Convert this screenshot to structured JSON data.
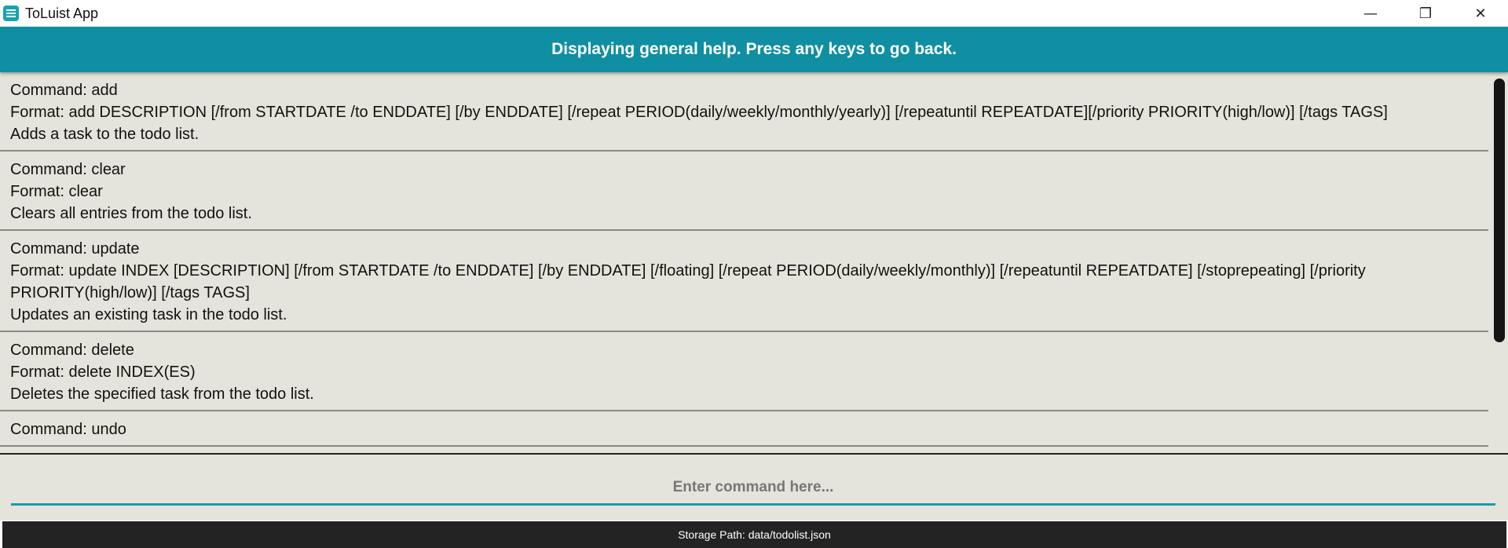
{
  "window": {
    "title": "ToLuist App",
    "icon": "checklist-icon",
    "controls": {
      "minimize": "—",
      "restore": "❐",
      "close": "✕"
    }
  },
  "banner": {
    "text": "Displaying general help. Press any keys to go back.",
    "color": "#0f8fa1"
  },
  "help": {
    "entries": [
      {
        "command": "Command: add",
        "format": "Format: add DESCRIPTION [/from STARTDATE /to ENDDATE] [/by ENDDATE] [/repeat PERIOD(daily/weekly/monthly/yearly)] [/repeatuntil REPEATDATE][/priority PRIORITY(high/low)] [/tags TAGS]",
        "description": "Adds a task to the todo list."
      },
      {
        "command": "Command: clear",
        "format": "Format: clear",
        "description": "Clears all entries from the todo list."
      },
      {
        "command": "Command: update",
        "format": "Format: update INDEX [DESCRIPTION] [/from STARTDATE /to ENDDATE] [/by ENDDATE] [/floating] [/repeat PERIOD(daily/weekly/monthly)] [/repeatuntil REPEATDATE] [/stoprepeating] [/priority PRIORITY(high/low)] [/tags TAGS]",
        "description": "Updates an existing task in the todo list."
      },
      {
        "command": "Command: delete",
        "format": "Format: delete INDEX(ES)",
        "description": "Deletes the specified task from the todo list."
      },
      {
        "command": "Command: undo",
        "format": "",
        "description": ""
      }
    ]
  },
  "input": {
    "placeholder": "Enter command here...",
    "value": ""
  },
  "status": {
    "storage_path": "Storage Path: data/todolist.json"
  }
}
